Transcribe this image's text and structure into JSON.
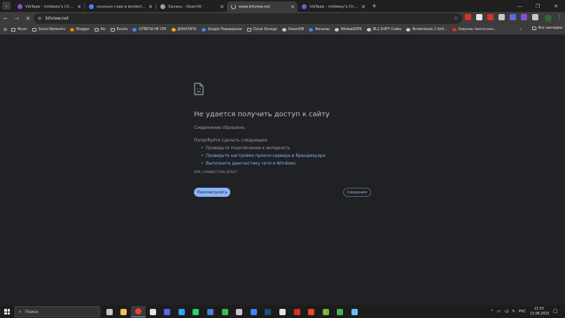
{
  "tabs": [
    {
      "title": "VidTape - mildewy's Channel",
      "fav_color": "#8a4fd8",
      "active": false
    },
    {
      "title": "сколько глав в borderlands th...",
      "fav_color": "#4285f4",
      "active": false
    },
    {
      "title": "Запись - OpenVK",
      "fav_color": "#9aa0a6",
      "active": false
    },
    {
      "title": "www.bitview.net",
      "fav_color": "#5f6368",
      "active": true
    },
    {
      "title": "VidTape - mildewy's Channel",
      "fav_color": "#8a4fd8",
      "active": false
    }
  ],
  "toolbar": {
    "url": "bitview.net",
    "extension_colors": [
      "#d93025",
      "#e3e3e3",
      "#d93025",
      "#c7c7c7",
      "#5b6ee1",
      "#8a4fd8",
      "#c7c7c7"
    ]
  },
  "bookmarks": {
    "items": [
      {
        "label": "Music",
        "icon": "folder-icon"
      },
      {
        "label": "Social Networks",
        "icon": "folder-icon"
      },
      {
        "label": "Blogger",
        "icon": "blogger-icon",
        "color": "#f57c00"
      },
      {
        "label": "Als",
        "icon": "folder-icon"
      },
      {
        "label": "Emails",
        "icon": "folder-icon"
      },
      {
        "label": "ОТВЕТЫ НЕ СРУ",
        "icon": "site-icon",
        "color": "#4285f4"
      },
      {
        "label": "ДОНАТИТЬ",
        "icon": "site-icon",
        "color": "#f9a825"
      },
      {
        "label": "Google Переводчик",
        "icon": "translate-icon",
        "color": "#4285f4"
      },
      {
        "label": "Cloud Storage",
        "icon": "folder-icon"
      },
      {
        "label": "SteamDB",
        "icon": "site-icon",
        "color": "#c7c7c7"
      },
      {
        "label": "Фильмы",
        "icon": "site-icon",
        "color": "#4285f4"
      },
      {
        "label": "MildewGDPS",
        "icon": "globe-icon",
        "color": "#c7c7c7"
      },
      {
        "label": "BL2 SHIFT Codes",
        "icon": "globe-icon",
        "color": "#c7c7c7"
      },
      {
        "label": "Borderlands 2 Skill...",
        "icon": "globe-icon",
        "color": "#c7c7c7"
      },
      {
        "label": "Озвучка текста онл...",
        "icon": "site-icon",
        "color": "#d93025"
      }
    ],
    "more": "»",
    "all_label": "Все закладки"
  },
  "error_page": {
    "title": "Не удается получить доступ к сайту",
    "subtitle": "Соединение сброшено.",
    "try_label": "Попробуйте сделать следующее:",
    "suggestions": [
      {
        "text": "Проверьте подключение к интернету.",
        "link": false
      },
      {
        "text": "Проверьте настройки прокси-сервера и брандмауэра.",
        "link": true
      },
      {
        "text": "Выполните диагностику сети в Windows.",
        "link": true
      }
    ],
    "error_code": "ERR_CONNECTION_RESET",
    "reload_label": "Перезагрузить",
    "details_label": "Сведения"
  },
  "taskbar": {
    "search_placeholder": "Поиск",
    "app_colors": [
      "#c7c7c7",
      "#f2c14e",
      "#ea4335",
      "#e3e3e3",
      "#5865f2",
      "#29a9eb",
      "#25d366",
      "#4a7fd8",
      "#3fb950",
      "#c7c7c7",
      "#4285f4",
      "#1f4e79",
      "#e3e3e3",
      "#d93025",
      "#e44d26",
      "#7cb342",
      "#4caf50",
      "#66c0f4"
    ],
    "active_index": 2,
    "lang": "РУС",
    "time": "21:55",
    "date": "13.08.2025"
  }
}
